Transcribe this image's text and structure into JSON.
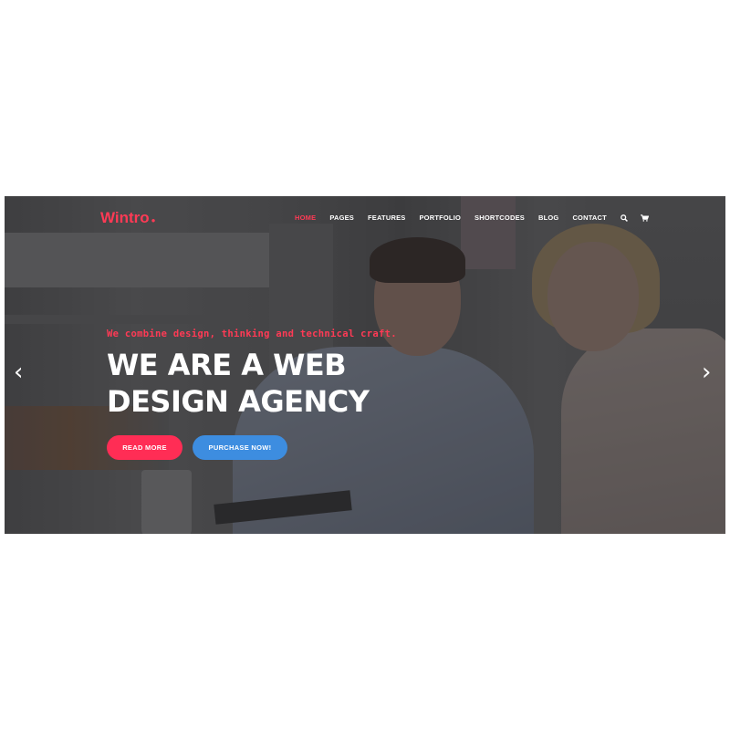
{
  "header": {
    "logo": "Wintro",
    "logo_dot": "●"
  },
  "nav": {
    "items": [
      {
        "label": "HOME",
        "active": true
      },
      {
        "label": "PAGES",
        "active": false
      },
      {
        "label": "FEATURES",
        "active": false
      },
      {
        "label": "PORTFOLIO",
        "active": false
      },
      {
        "label": "SHORTCODES",
        "active": false
      },
      {
        "label": "BLOG",
        "active": false
      },
      {
        "label": "CONTACT",
        "active": false
      }
    ],
    "icons": [
      "search-icon",
      "cart-icon"
    ]
  },
  "hero": {
    "tagline": "We combine design, thinking and technical craft.",
    "headline_line1": "WE ARE A WEB",
    "headline_line2": "DESIGN AGENCY",
    "read_more": "READ MORE",
    "purchase": "PURCHASE NOW!",
    "prev_arrow": "‹",
    "next_arrow": "›"
  },
  "colors": {
    "accent": "#ff3a55",
    "primary_button": "#ff2d55",
    "secondary_button": "#3d8de0"
  }
}
